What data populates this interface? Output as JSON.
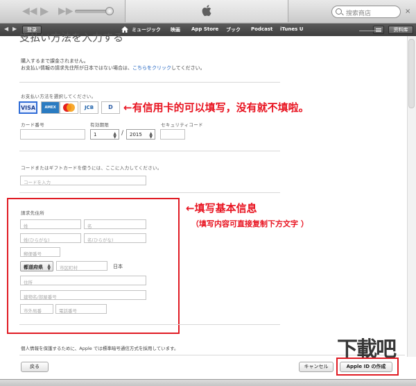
{
  "toolbar": {
    "search_placeholder": "搜索商店",
    "close_label": "×"
  },
  "navbar": {
    "login_label": "登录",
    "items": [
      "ミュージック",
      "映画",
      "App Store",
      "ブック",
      "Podcast",
      "iTunes U"
    ],
    "library_label": "资料库"
  },
  "page": {
    "heading": "支払い方法を入力する",
    "notice_line1": "購入するまで課金されません。",
    "notice_line2_pre": "お支払い情報の請求先住所が日本ではない場合は、",
    "notice_line2_link": "こちらをクリック",
    "notice_line2_post": "してください。",
    "payment_label": "お支払い方法を選択してください。",
    "cards": [
      "VISA",
      "AMEX",
      "MC",
      "JCB",
      "D"
    ],
    "card_number_label": "カード番号",
    "expiry_label": "有効期限",
    "security_code_label": "セキュリティコード",
    "expiry_month": "1",
    "expiry_year": "2015",
    "expiry_sep": "/",
    "gift_label": "コードまたはギフトカードを使うには、ここに入力してください。",
    "gift_placeholder": "コードを入力",
    "billing_label": "請求先住所",
    "last_name": "姓",
    "first_name": "名",
    "last_name_kana": "姓(ひらがな)",
    "first_name_kana": "名(ひらがな)",
    "postal_code": "郵便番号",
    "prefecture": "都道府県",
    "city": "市区町村",
    "country": "日本",
    "address": "住所",
    "building": "建物名/部屋番号",
    "area_code": "市外局番",
    "phone": "電話番号",
    "security_note": "個人情報を保護するために、Apple では標準暗号通信方式を採用しています。",
    "back_label": "戻る",
    "cancel_label": "キャンセル",
    "create_label": "Apple ID の作成"
  },
  "annotations": {
    "card_note": "←有信用卡的可以填写，没有就不填啦。",
    "info_note": "←填写基本信息",
    "info_sub": "（填写内容可直接复制下方文字 ）"
  },
  "colors": {
    "annotation_red": "#e8121f",
    "link_blue": "#1a5fbf",
    "nav_bg": "#4a4a4a"
  }
}
